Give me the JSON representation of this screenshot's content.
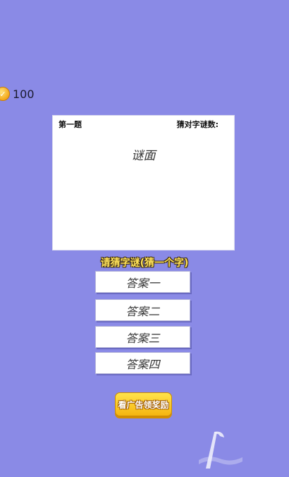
{
  "coins": {
    "icon": "coin-icon",
    "value": "100"
  },
  "question": {
    "number_label": "第一题",
    "solved_label": "猜对字谜数:",
    "riddle_text": "谜面"
  },
  "prompt": "请猜字谜(猜一个字)",
  "answers": [
    "答案一",
    "答案二",
    "答案三",
    "答案四"
  ],
  "ad_button": "看广告领奖励",
  "colors": {
    "background": "#8a8ae6",
    "panel": "#ffffff",
    "prompt_text": "#ffe25a",
    "ad_button": "#f6b510"
  }
}
